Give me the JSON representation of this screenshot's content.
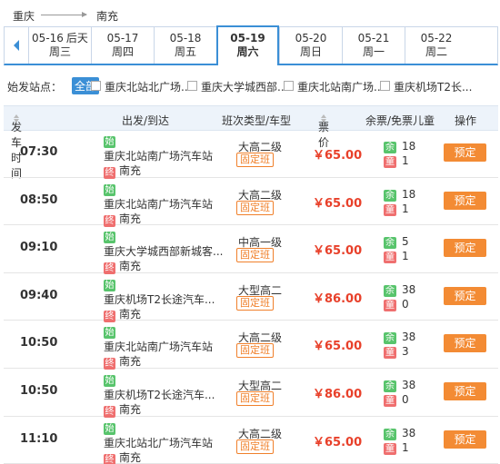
{
  "route": {
    "from": "重庆",
    "to": "南充"
  },
  "dates": [
    {
      "date": "05-16",
      "suffix": "后天",
      "weekday": "周三"
    },
    {
      "date": "05-17",
      "suffix": "",
      "weekday": "周四"
    },
    {
      "date": "05-18",
      "suffix": "",
      "weekday": "周五"
    },
    {
      "date": "05-19",
      "suffix": "",
      "weekday": "周六",
      "active": true
    },
    {
      "date": "05-20",
      "suffix": "",
      "weekday": "周日"
    },
    {
      "date": "05-21",
      "suffix": "",
      "weekday": "周一"
    },
    {
      "date": "05-22",
      "suffix": "",
      "weekday": "周二"
    }
  ],
  "filter": {
    "label": "始发站点：",
    "all_label": "全部",
    "options": [
      "重庆北站北广场...",
      "重庆大学城西部...",
      "重庆北站南广场...",
      "重庆机场T2长..."
    ]
  },
  "table": {
    "headers": {
      "time": "发车时间",
      "route": "出发/到达",
      "type": "班次类型/车型",
      "price": "票价",
      "remain": "余票/免票儿童",
      "action": "操作"
    },
    "start_badge": "始",
    "end_badge": "终",
    "remain_badge": "余",
    "child_badge": "童",
    "fixed_label": "固定班",
    "book_label": "预定",
    "rows": [
      {
        "time": "07:30",
        "origin": "重庆北站南广场汽车站",
        "dest": "南充",
        "bus": "大高二级",
        "price": "￥65.00",
        "remain": "18",
        "child": "1"
      },
      {
        "time": "08:50",
        "origin": "重庆北站南广场汽车站",
        "dest": "南充",
        "bus": "大高二级",
        "price": "￥65.00",
        "remain": "18",
        "child": "1"
      },
      {
        "time": "09:10",
        "origin": "重庆大学城西部新城客...",
        "dest": "南充",
        "bus": "中高一级",
        "price": "￥65.00",
        "remain": "5",
        "child": "1"
      },
      {
        "time": "09:40",
        "origin": "重庆机场T2长途汽车...",
        "dest": "南充",
        "bus": "大型高二",
        "price": "￥86.00",
        "remain": "38",
        "child": "0"
      },
      {
        "time": "10:50",
        "origin": "重庆北站南广场汽车站",
        "dest": "南充",
        "bus": "大高二级",
        "price": "￥65.00",
        "remain": "38",
        "child": "3"
      },
      {
        "time": "10:50",
        "origin": "重庆机场T2长途汽车...",
        "dest": "南充",
        "bus": "大型高二",
        "price": "￥86.00",
        "remain": "38",
        "child": "0"
      },
      {
        "time": "11:10",
        "origin": "重庆北站北广场汽车站",
        "dest": "南充",
        "bus": "大高二级",
        "price": "￥65.00",
        "remain": "38",
        "child": "1"
      }
    ]
  },
  "colors": {
    "accent": "#3b8fd6",
    "price": "#e8402a",
    "book": "#f38b34",
    "start": "#58c46c",
    "end": "#ef6f6f"
  }
}
